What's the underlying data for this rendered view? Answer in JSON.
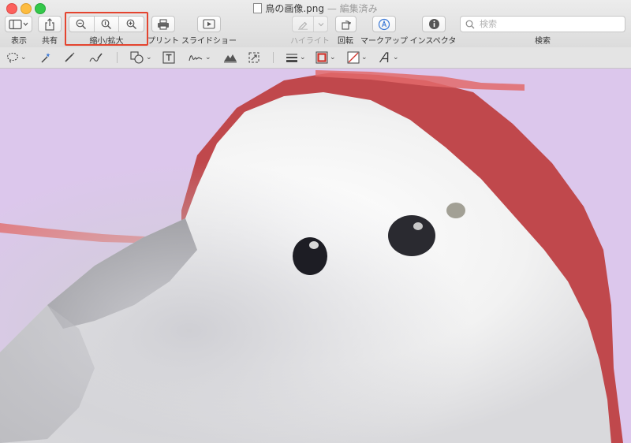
{
  "window": {
    "filename": "鳥の画像.png",
    "separator": " — ",
    "status": "編集済み"
  },
  "toolbar": {
    "view_label": "表示",
    "share_label": "共有",
    "zoom_label": "縮小/拡大",
    "print_label": "プリント",
    "slideshow_label": "スライドショー",
    "highlight_label": "ハイライト",
    "rotate_label": "回転",
    "markup_label": "マークアップ",
    "inspector_label": "インスペクタ",
    "search_label": "検索",
    "search_placeholder": "検索"
  },
  "colors": {
    "highlight_box": "#e4442f",
    "canvas_background": "#dcc7ec",
    "bird_white": "#f4f4f4",
    "red_shape": "#c0484c"
  },
  "markup_tools": [
    "sketch-selection-icon",
    "instant-alpha-icon",
    "sketch-icon",
    "draw-icon",
    "shapes-icon",
    "text-icon",
    "sign-icon",
    "adjust-color-icon",
    "adjust-size-icon",
    "shape-style-icon",
    "border-color-icon",
    "fill-color-icon",
    "text-style-icon"
  ]
}
